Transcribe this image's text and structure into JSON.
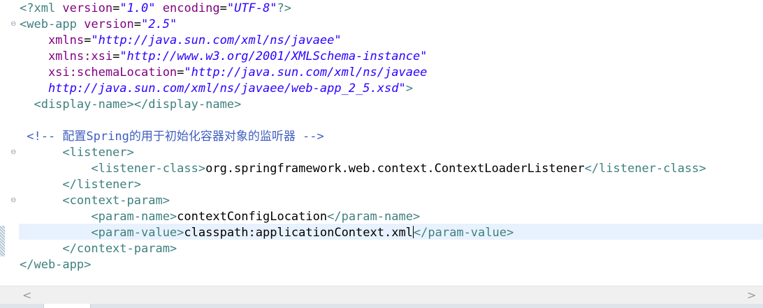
{
  "colors": {
    "tag": "#3f7f7f",
    "attribute": "#7f007f",
    "value": "#2a00ff",
    "comment": "#3f5fbf",
    "text": "#000000",
    "current_line": "#e8f2fe"
  },
  "icons": {
    "fold": "collapse-minus-icon",
    "scroll_left": "chevron-left-icon",
    "scroll_right": "chevron-right-icon"
  },
  "code": {
    "l1": {
      "p1": "<?xml ",
      "p2": "version",
      "p3": "=",
      "p4": "\"1.0\"",
      "p5": " encoding",
      "p6": "=",
      "p7": "\"UTF-8\"",
      "p8": "?>"
    },
    "l2": {
      "p1": "<web-app ",
      "p2": "version",
      "p3": "=",
      "p4": "\"2.5\""
    },
    "l3": {
      "p1": "    xmlns",
      "p2": "=",
      "p3": "\"http://java.sun.com/xml/ns/javaee\""
    },
    "l4": {
      "p1": "    xmlns:xsi",
      "p2": "=",
      "p3": "\"http://www.w3.org/2001/XMLSchema-instance\""
    },
    "l5": {
      "p1": "    xsi:schemaLocation",
      "p2": "=",
      "p3": "\"http://java.sun.com/xml/ns/javaee"
    },
    "l6": {
      "p1": "    http://java.sun.com/xml/ns/javaee/web-app_2_5.xsd\"",
      "p2": ">"
    },
    "l7": {
      "p1": "  <display-name></display-name>"
    },
    "l9": {
      "p1": " <!-- 配置Spring的用于初始化容器对象的监听器 -->"
    },
    "l10": {
      "p1": "      <listener>"
    },
    "l11": {
      "p1": "          <listener-class>",
      "p2": "org.springframework.web.context.ContextLoaderListener",
      "p3": "</listener-class>"
    },
    "l12": {
      "p1": "      </listener>"
    },
    "l13": {
      "p1": "      <context-param>"
    },
    "l14": {
      "p1": "          <param-name>",
      "p2": "contextConfigLocation",
      "p3": "</param-name>"
    },
    "l15": {
      "p1": "          <param-value>",
      "p2": "classpath:applicationContext.xml",
      "p3": "</param-value>"
    },
    "l16": {
      "p1": "      </context-param>"
    },
    "l17": {
      "p1": "</web-app>"
    }
  }
}
